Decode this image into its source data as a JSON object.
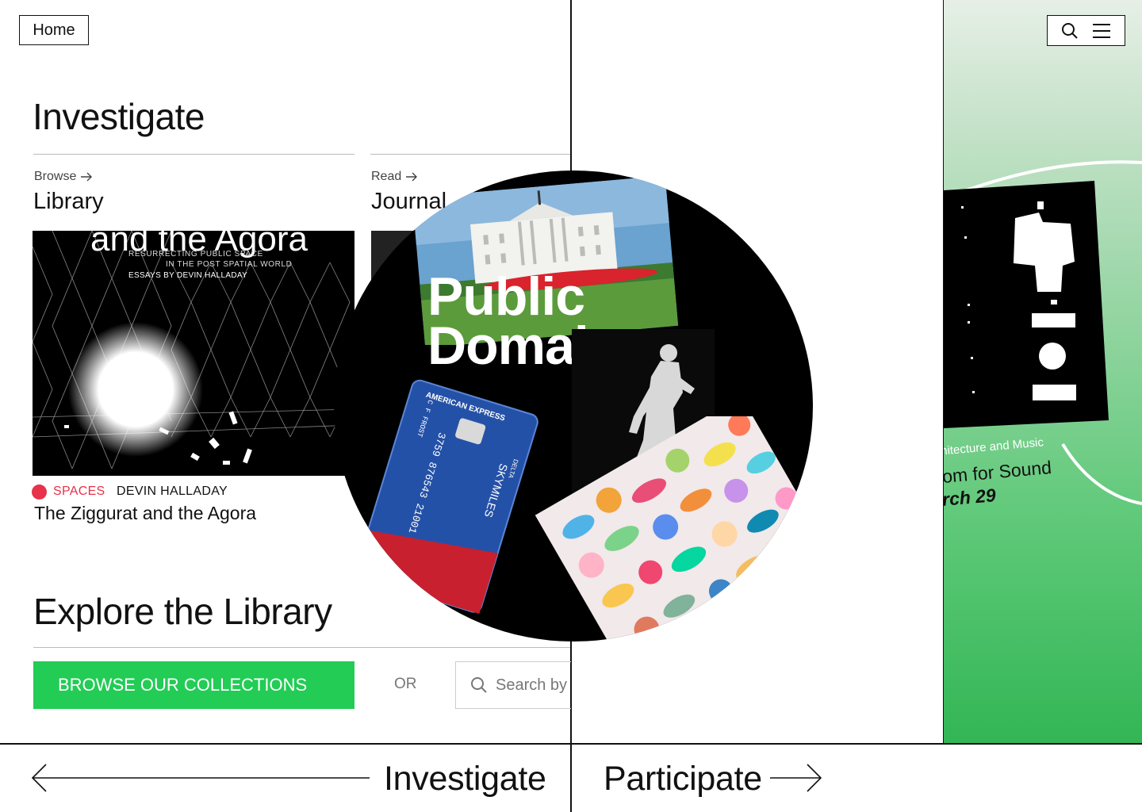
{
  "header": {
    "home_label": "Home"
  },
  "investigate": {
    "heading": "Investigate",
    "cards": [
      {
        "link": "Browse",
        "title": "Library"
      },
      {
        "link": "Read",
        "title": "Journal"
      }
    ],
    "featured_book": {
      "cover_title": "and the Agora",
      "cover_subtitle_1": "RESURRECTING PUBLIC SPACE",
      "cover_subtitle_2": "IN THE POST SPATIAL WORLD",
      "cover_byline": "ESSAYS BY DEVIN HALLADAY",
      "tag": "SPACES",
      "author": "DEVIN HALLADAY",
      "title": "The Ziggurat and the Agora"
    },
    "explore": {
      "heading": "Explore the Library",
      "browse_button": "BROWSE OUR COLLECTIONS",
      "or": "OR",
      "search_placeholder": "Search by"
    }
  },
  "overlay": {
    "title_line1": "Public",
    "title_line2": "Domain",
    "card_brand": "AMERICAN EXPRESS",
    "card_product": "SKYMILES",
    "card_number": "3759 876543 21001",
    "card_name": "C F FROST",
    "card_issuer": "DELTA"
  },
  "participate_panel": {
    "line1": "hitecture and Music",
    "line2": "om for Sound",
    "line3": "rch 29"
  },
  "footer": {
    "left_label": "Investigate",
    "right_label": "Participate"
  },
  "colors": {
    "accent_green": "#22cc55",
    "tag_red": "#e8314a"
  }
}
